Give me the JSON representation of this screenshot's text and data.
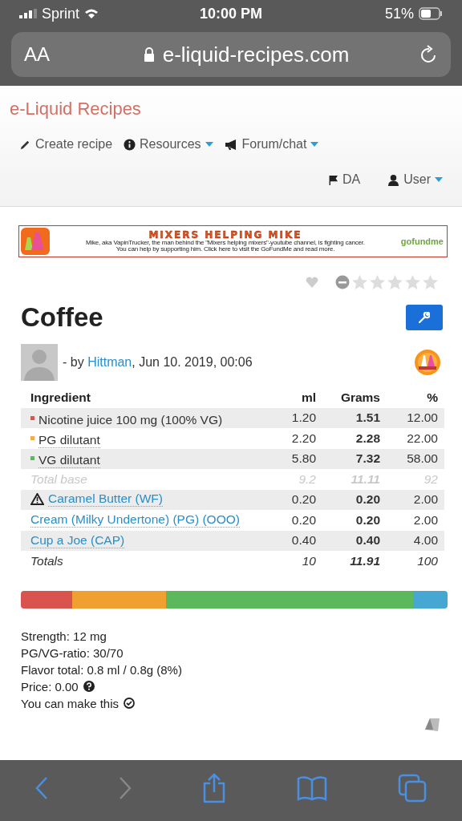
{
  "status_bar": {
    "carrier": "Sprint",
    "time": "10:00 PM",
    "battery": "51%"
  },
  "browser": {
    "text_size": "AA",
    "url": "e-liquid-recipes.com"
  },
  "site": {
    "brand": "e-Liquid Recipes",
    "nav": [
      {
        "label": "Create recipe",
        "kind": "pencil",
        "dropdown": false
      },
      {
        "label": "Resources",
        "kind": "info",
        "dropdown": true
      },
      {
        "label": "Forum/chat",
        "kind": "megaphone",
        "dropdown": true
      }
    ],
    "nav_right": [
      {
        "label": "DA",
        "kind": "flag",
        "dropdown": false
      },
      {
        "label": "User",
        "kind": "user",
        "dropdown": true
      }
    ]
  },
  "banner": {
    "title": "MIXERS HELPING MIKE",
    "lines": [
      "Mike, aka VapinTrucker, the man behind the \"Mixers helping mixers\"-youtube channel, is fighting cancer.",
      "You can help by supporting him. Click here to visit the GoFundMe and read more."
    ],
    "logo": "gofundme"
  },
  "rating": {
    "favorite": false,
    "stars": 0
  },
  "recipe": {
    "title": "Coffee",
    "by": "- by ",
    "author": "Hittman",
    "date": ", Jun 10. 2019, 00:06"
  },
  "table": {
    "columns": [
      "Ingredient",
      "ml",
      "Grams",
      "%"
    ],
    "rows": [
      {
        "kind": "base",
        "name": "Nicotine juice 100 mg (100% VG)",
        "color": "#d9534f",
        "ml": "1.20",
        "grams": "1.51",
        "percent": "12.00"
      },
      {
        "kind": "base",
        "name": "PG dilutant",
        "color": "#f0ad4e",
        "ml": "2.20",
        "grams": "2.28",
        "percent": "22.00"
      },
      {
        "kind": "base",
        "name": "VG dilutant",
        "color": "#5cb85c",
        "ml": "5.80",
        "grams": "7.32",
        "percent": "58.00"
      },
      {
        "kind": "subtotal",
        "name": "Total base",
        "ml": "9.2",
        "grams": "11.11",
        "percent": "92"
      },
      {
        "kind": "flavor",
        "warning": true,
        "name": "Caramel Butter (WF)",
        "ml": "0.20",
        "grams": "0.20",
        "percent": "2.00"
      },
      {
        "kind": "flavor",
        "warning": false,
        "name": "Cream (Milky Undertone) (PG) (OOO)",
        "ml": "0.20",
        "grams": "0.20",
        "percent": "2.00"
      },
      {
        "kind": "flavor",
        "warning": false,
        "name": "Cup a Joe (CAP)",
        "ml": "0.40",
        "grams": "0.40",
        "percent": "4.00"
      },
      {
        "kind": "total",
        "name": "Totals",
        "ml": "10",
        "grams": "11.91",
        "percent": "100"
      }
    ]
  },
  "mix_bar": [
    {
      "color": "#d9534f"
    },
    {
      "color": "#f0a030"
    },
    {
      "color": "#5cb85c"
    },
    {
      "color": "#46a8d2"
    }
  ],
  "stats": [
    {
      "kind": "plain",
      "text": "Strength: 12 mg"
    },
    {
      "kind": "plain",
      "text": "PG/VG-ratio: 30/70"
    },
    {
      "kind": "plain",
      "text": "Flavor total: 0.8 ml / 0.8g (8%)"
    },
    {
      "kind": "help",
      "text": "Price: 0.00"
    },
    {
      "kind": "check",
      "text": "You can make this"
    }
  ],
  "toolbar": {
    "back_disabled": false,
    "forward_disabled": true
  }
}
